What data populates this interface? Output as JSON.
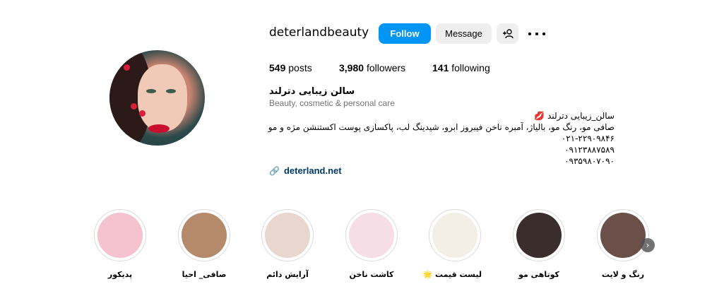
{
  "profile": {
    "username": "deterlandbeauty",
    "follow_label": "Follow",
    "message_label": "Message",
    "stats": {
      "posts_count": "549",
      "posts_label": "posts",
      "followers_count": "3,980",
      "followers_label": "followers",
      "following_count": "141",
      "following_label": "following"
    },
    "full_name": "سالن زیبایی دترلند",
    "category": "Beauty, cosmetic & personal care",
    "bio_lines": [
      "سالن_زیبایی دترلند 💋",
      "صافی مو، رنگ مو، بالیاژ، آمبره ناخن فیبروز ابرو، شیدینگ لب، پاکسازی پوست اکستنشن مژه و مو",
      "۰۲۱-۲۲۹۰۹۸۴۶",
      "۰۹۱۲۳۸۸۷۵۸۹",
      "۰۹۳۵۹۸۰۷۰۹۰"
    ],
    "link": "deterland.net"
  },
  "highlights": [
    {
      "label": "پدیکور",
      "color": "#f4c3cf"
    },
    {
      "label": "صافی_ احیا",
      "color": "#b58a6b"
    },
    {
      "label": "آرایش دائم",
      "color": "#e8d6cf"
    },
    {
      "label": "کاشت ناخن",
      "color": "#f7dde6"
    },
    {
      "label": "لیست قیمت 🌟",
      "color": "#f3efe6"
    },
    {
      "label": "کوتاهی مو",
      "color": "#3a2e2c"
    },
    {
      "label": "رنگ و لایت",
      "color": "#6b4f49"
    }
  ],
  "colors": {
    "accent": "#0095f6",
    "link": "#00376b"
  }
}
